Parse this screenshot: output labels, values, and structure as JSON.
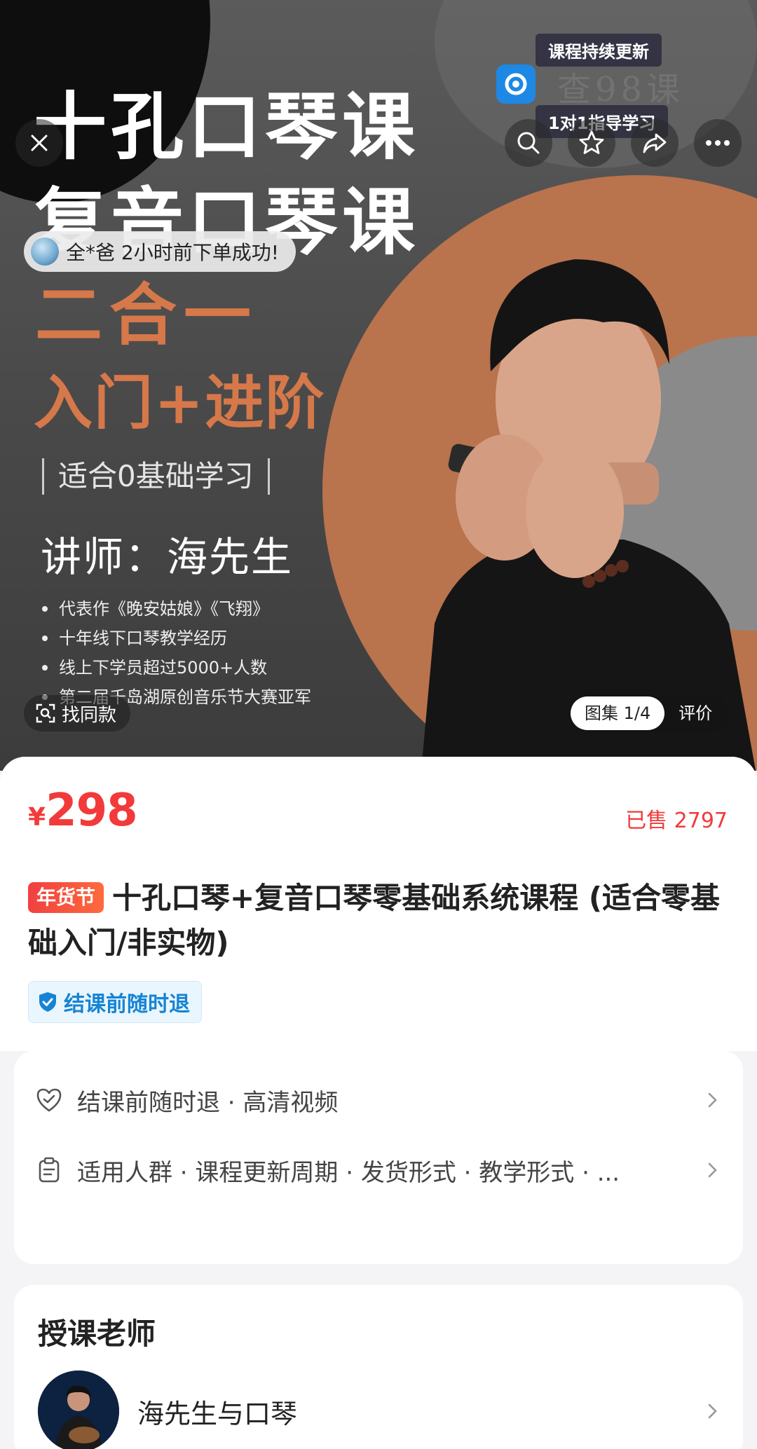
{
  "hero": {
    "title_line1": "十孔口琴课",
    "title_line2": "复音口琴课",
    "two_in_one": "二合一",
    "levels": "入门+进阶",
    "suitable": "适合0基础学习",
    "teacher_line": "讲师：海先生",
    "bullets": [
      "代表作《晚安姑娘》《飞翔》",
      "十年线下口琴教学经历",
      "线上下学员超过5000+人数",
      "第二届千岛湖原创音乐节大赛亚军"
    ],
    "toast_text": "全*爸 2小时前下单成功!",
    "watermark_tag1": "课程持续更新",
    "watermark_text": "查98课",
    "watermark_tag2": "1对1指导学习",
    "find_same": "找同款",
    "gallery_tabs": [
      "图集 1/4",
      "评价"
    ]
  },
  "product": {
    "currency": "¥",
    "price": "298",
    "sold": "已售 2797",
    "festival_tag": "年货节",
    "title": "十孔口琴+复音口琴零基础系统课程 (适合零基础入门/非实物)",
    "refund_badge": "结课前随时退"
  },
  "attributes": [
    {
      "icon": "heart-shield-icon",
      "text": "结课前随时退 · 高清视频"
    },
    {
      "icon": "clipboard-icon",
      "text": "适用人群 · 课程更新周期 · 发货形式 · 教学形式 · ..."
    }
  ],
  "teacher": {
    "heading": "授课老师",
    "name": "海先生与口琴"
  },
  "colors": {
    "accent_red": "#f23a3a",
    "hero_orange": "#d6784a",
    "refund_blue": "#1684d4"
  }
}
